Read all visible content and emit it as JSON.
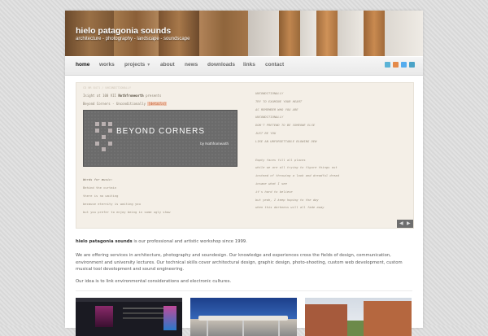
{
  "site": {
    "title": "hielo patagonia sounds",
    "tagline": "architecture - photography - landscape - soundscape"
  },
  "nav": {
    "items": [
      {
        "label": "home",
        "active": true
      },
      {
        "label": "works"
      },
      {
        "label": "projects"
      },
      {
        "label": "about"
      },
      {
        "label": "news"
      },
      {
        "label": "downloads"
      },
      {
        "label": "links"
      },
      {
        "label": "contact"
      }
    ],
    "social_icons": [
      {
        "name": "skype-icon",
        "color": "#5bb3d6"
      },
      {
        "name": "rss-icon",
        "color": "#e48a4a"
      },
      {
        "name": "twitter-icon",
        "color": "#55acee"
      },
      {
        "name": "vimeo-icon",
        "color": "#4ba3c7"
      }
    ]
  },
  "slider": {
    "top_note": "CD NR 8471 / UNCONDITIONALLY",
    "presents_prefix": "Isight at 100 VII",
    "presents_name": "Nothfromearth",
    "presents_suffix": "presents",
    "album_line_prefix": "Beyond Corners - Unconditionally",
    "album_line_link": "[details]",
    "album_title": "BEYOND CORNERS",
    "album_by": "by Nothfromearth",
    "left_lyrics_head": "Words for music:",
    "left_lyrics": [
      "Behind the curtain",
      "there is no waiting",
      "because eternity is waiting you",
      "but you prefer to enjoy being in some ugly show"
    ],
    "right_lyrics_a": [
      "UNCONDITIONALLY",
      "TRY TO EXAMINE YOUR HEART",
      "AS REMEMBER WHO YOU ARE",
      "UNCONDITIONALLY",
      "DON'T PRETEND TO BE SOMEONE ELSE",
      "JUST BE YOU",
      "LIKE AN UNFORGETTABLE BLOWING DEW"
    ],
    "right_lyrics_b": [
      "Empty faces fill all places",
      "while we are all trying to figure things out",
      "instead of throwing a look and dreadful dread",
      "insane what I see",
      "it's hard to believe",
      "but yeah, I keep hoping to the day",
      "when this darkness will all fade away"
    ]
  },
  "intro": {
    "name": "hielo patagonia sounds",
    "rest": " is our professional and artistic workshop since 1999."
  },
  "paragraph2": "We are offering services in architecture, photography and soundesign. Our knowledge and experiences cross the fields of design, communication, environment and university lectures. Our technical skills cover architectural design, graphic design, photo-shooting, custom web development, custom musical tool development and sound engineering.",
  "paragraph3": "Our idea is to link environmental considerations and electronic cultures."
}
